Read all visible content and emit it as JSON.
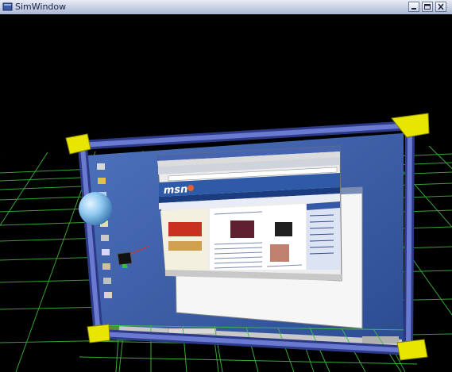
{
  "window": {
    "title": "SimWindow",
    "controls": [
      "minimize-icon",
      "maximize-icon",
      "close-icon"
    ]
  },
  "scene": {
    "background": "#000000",
    "grid_color": "#3fbf3f",
    "panel_color": "#3a5ea8",
    "frame_color": "#5466b4",
    "corner_color": "#e8e600",
    "sphere_color": "#8ec8f0",
    "browser_logo": "msn"
  }
}
